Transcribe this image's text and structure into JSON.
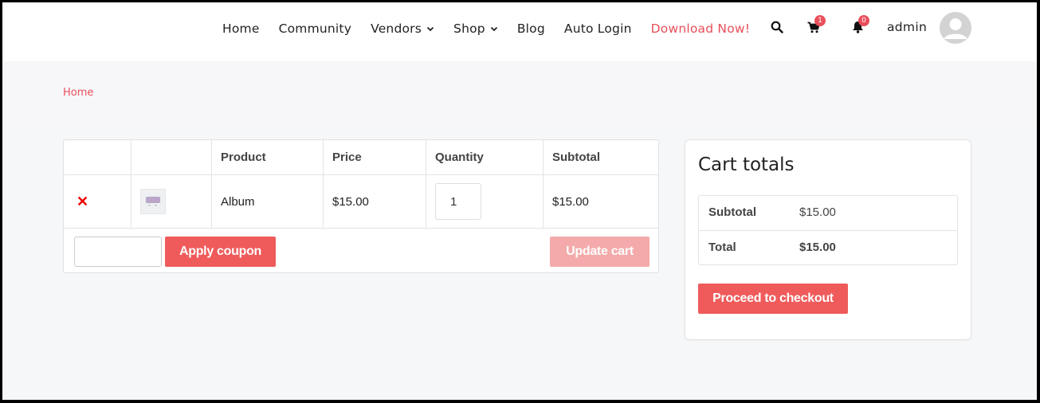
{
  "nav": {
    "items": [
      {
        "label": "Home"
      },
      {
        "label": "Community"
      },
      {
        "label": "Vendors"
      },
      {
        "label": "Shop"
      },
      {
        "label": "Blog"
      },
      {
        "label": "Auto Login"
      },
      {
        "label": "Download Now!"
      }
    ],
    "icons": [
      "search-icon",
      "cart-icon",
      "bell-icon"
    ],
    "cart_count": "1",
    "notification_count": "0",
    "user_name": "admin"
  },
  "breadcrumb": {
    "home": "Home"
  },
  "cart": {
    "headers": {
      "product": "Product",
      "price": "Price",
      "quantity": "Quantity",
      "subtotal": "Subtotal"
    },
    "rows": [
      {
        "product": "Album",
        "price": "$15.00",
        "quantity": "1",
        "subtotal": "$15.00"
      }
    ],
    "apply_coupon": "Apply coupon",
    "update_cart": "Update cart"
  },
  "totals": {
    "title": "Cart totals",
    "subtotal_label": "Subtotal",
    "subtotal_value": "$15.00",
    "total_label": "Total",
    "total_value": "$15.00",
    "checkout": "Proceed to checkout"
  },
  "colors": {
    "accent": "#e8505b",
    "button": "#ef5b5b",
    "button_disabled": "#f4aaaa",
    "remove": "#e00000"
  }
}
